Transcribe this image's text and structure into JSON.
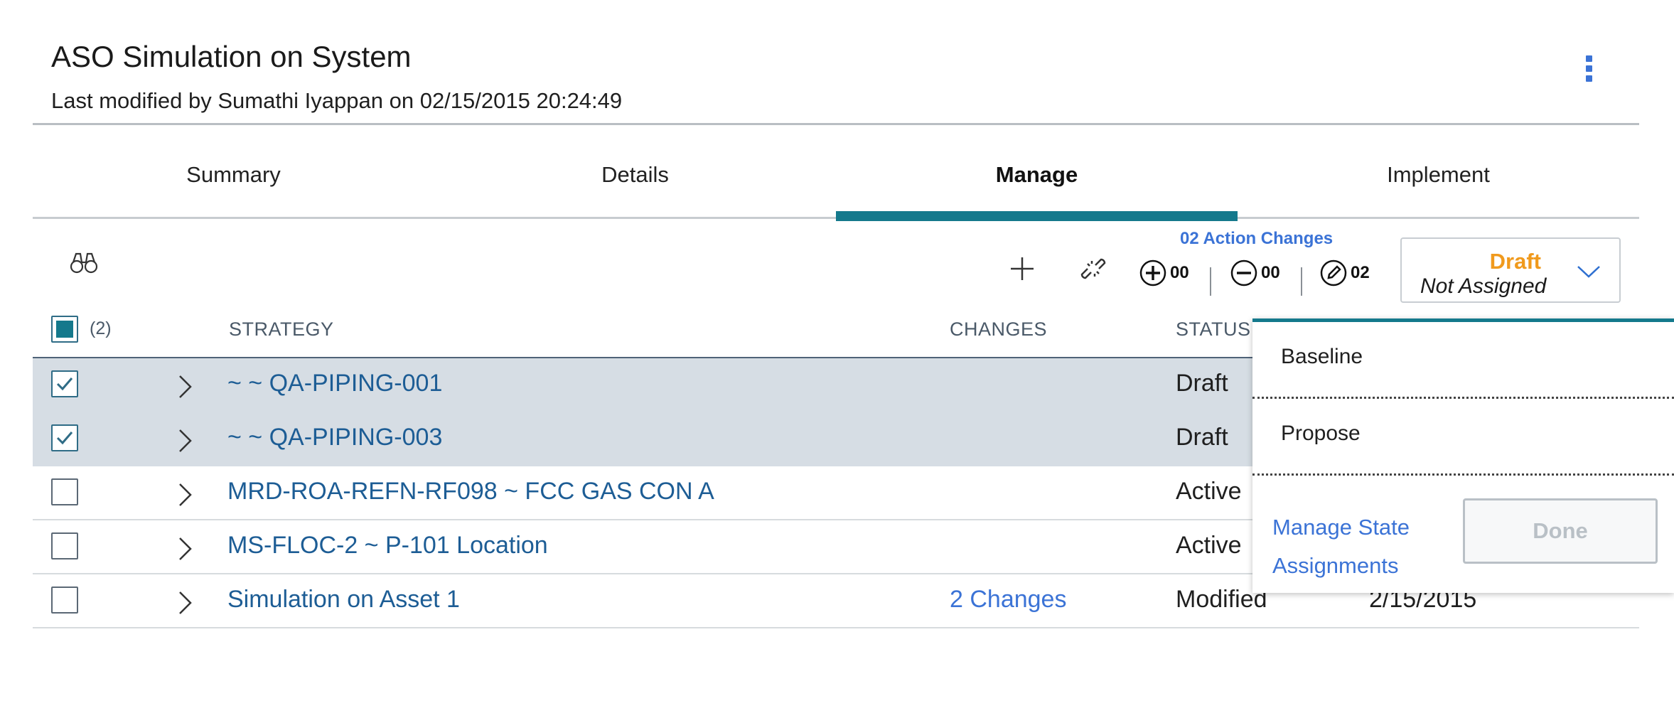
{
  "header": {
    "title": "ASO Simulation on System",
    "subtitle": "Last modified by Sumathi Iyappan on 02/15/2015 20:24:49"
  },
  "tabs": [
    {
      "label": "Summary"
    },
    {
      "label": "Details"
    },
    {
      "label": "Manage",
      "active": true
    },
    {
      "label": "Implement"
    }
  ],
  "toolbar": {
    "action_changes_label": "02 Action Changes",
    "added_count": "00",
    "removed_count": "00",
    "edited_count": "02",
    "state": {
      "status": "Draft",
      "assignment": "Not Assigned"
    }
  },
  "table": {
    "selected_count": "(2)",
    "columns": {
      "strategy": "STRATEGY",
      "changes": "CHANGES",
      "status": "STATUS"
    },
    "rows": [
      {
        "strategy": "~ ~ QA-PIPING-001",
        "changes": "",
        "status": "Draft",
        "date": "",
        "checked": true
      },
      {
        "strategy": "~ ~ QA-PIPING-003",
        "changes": "",
        "status": "Draft",
        "date": "",
        "checked": true
      },
      {
        "strategy": "MRD-ROA-REFN-RF098 ~ FCC GAS CON A",
        "changes": "",
        "status": "Active",
        "date": "",
        "checked": false
      },
      {
        "strategy": "MS-FLOC-2 ~ P-101 Location",
        "changes": "",
        "status": "Active",
        "date": "",
        "checked": false
      },
      {
        "strategy": "Simulation on Asset 1",
        "changes": "2 Changes",
        "status": "Modified",
        "date": "2/15/2015",
        "checked": false
      }
    ]
  },
  "state_menu": {
    "options": [
      "Baseline",
      "Propose"
    ],
    "manage_link": "Manage State Assignments",
    "done_label": "Done"
  },
  "colors": {
    "accent": "#14798c",
    "link": "#3b73d6",
    "draft": "#f09a1d",
    "selected_row": "#d6dde4"
  }
}
